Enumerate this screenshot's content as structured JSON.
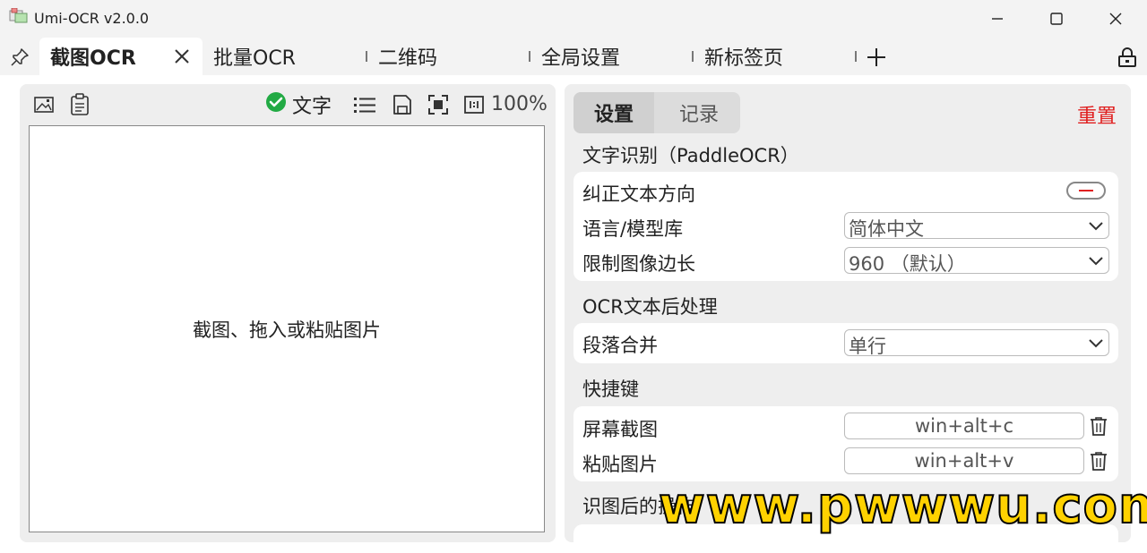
{
  "window": {
    "title": "Umi-OCR v2.0.0"
  },
  "tabs": [
    {
      "label": "截图OCR",
      "active": true
    },
    {
      "label": "批量OCR"
    },
    {
      "label": "二维码"
    },
    {
      "label": "全局设置"
    },
    {
      "label": "新标签页"
    }
  ],
  "left_panel": {
    "text_toggle_label": "文字",
    "zoom": "100%",
    "canvas_hint": "截图、拖入或粘贴图片"
  },
  "right_panel": {
    "tabs": {
      "settings": "设置",
      "history": "记录"
    },
    "reset_label": "重置",
    "section_ocr": "文字识别（PaddleOCR）",
    "correct_direction_label": "纠正文本方向",
    "language_label": "语言/模型库",
    "language_value": "简体中文",
    "limit_size_label": "限制图像边长",
    "limit_size_value": "960 （默认）",
    "section_post": "OCR文本后处理",
    "paragraph_label": "段落合并",
    "paragraph_value": "单行",
    "section_hotkey": "快捷键",
    "screenshot_label": "屏幕截图",
    "screenshot_key": "win+alt+c",
    "paste_label": "粘贴图片",
    "paste_key": "win+alt+v",
    "section_after": "识图后的操作"
  },
  "watermark": "www.pwwwu.com",
  "colors": {
    "accent_red": "#e02020",
    "check_green": "#22aa44"
  }
}
